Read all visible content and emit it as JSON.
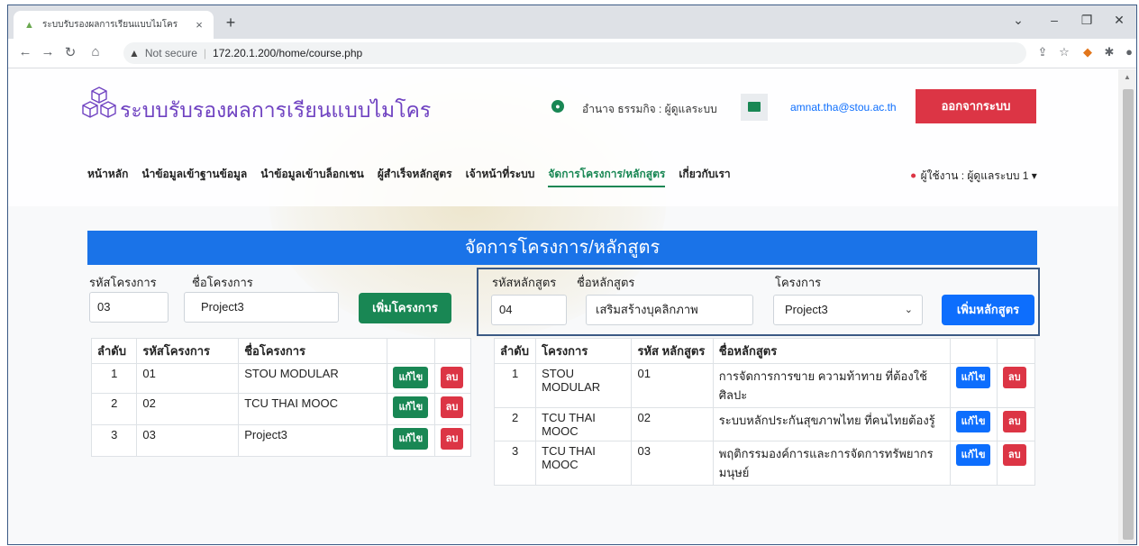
{
  "browser": {
    "tab_title": "ระบบรับรองผลการเรียนแบบไมโคร",
    "tab_close": "×",
    "new_tab": "+",
    "address_security": "Not secure",
    "address_url": "172.20.1.200/home/course.php"
  },
  "header": {
    "site_title": "ระบบรับรองผลการเรียนแบบไมโคร",
    "user_info": "อำนาจ ธรรมกิจ : ผู้ดูแลระบบ",
    "email": "amnat.tha@stou.ac.th",
    "logout_label": "ออกจากระบบ"
  },
  "nav": {
    "items": [
      {
        "label": "หน้าหลัก"
      },
      {
        "label": "นำข้อมูลเข้าฐานข้อมูล"
      },
      {
        "label": "นำข้อมูลเข้าบล็อกเชน"
      },
      {
        "label": "ผู้สำเร็จหลักสูตร"
      },
      {
        "label": "เจ้าหน้าที่ระบบ"
      },
      {
        "label": "จัดการโครงการ/หลักสูตร"
      },
      {
        "label": "เกี่ยวกับเรา"
      }
    ],
    "active_index": 5,
    "user_menu": "ผู้ใช้งาน : ผู้ดูแลระบบ 1"
  },
  "main": {
    "banner_title": "จัดการโครงการ/หลักสูตร",
    "project_form": {
      "code_label": "รหัสโครงการ",
      "code_value": "03",
      "name_label": "ชื่อโครงการ",
      "name_value": "Project3",
      "add_button": "เพิ่มโครงการ"
    },
    "course_form": {
      "code_label": "รหัสหลักสูตร",
      "code_value": "04",
      "name_label": "ชื่อหลักสูตร",
      "name_value": "เสริมสร้างบุคลิกภาพ",
      "project_label": "โครงการ",
      "project_selected": "Project3",
      "add_button": "เพิ่มหลักสูตร"
    },
    "project_table": {
      "headers": [
        "ลำดับ",
        "รหัสโครงการ",
        "ชื่อโครงการ"
      ],
      "rows": [
        {
          "no": "1",
          "code": "01",
          "name": "STOU MODULAR"
        },
        {
          "no": "2",
          "code": "02",
          "name": "TCU THAI MOOC"
        },
        {
          "no": "3",
          "code": "03",
          "name": "Project3"
        }
      ],
      "edit_label": "แก้ไข",
      "delete_label": "ลบ"
    },
    "course_table": {
      "headers": [
        "ลำดับ",
        "โครงการ",
        "รหัส หลักสูตร",
        "ชื่อหลักสูตร"
      ],
      "rows": [
        {
          "no": "1",
          "project": "STOU MODULAR",
          "code": "01",
          "name": "การจัดการการขาย ความท้าทาย ที่ต้องใช้ศิลปะ"
        },
        {
          "no": "2",
          "project": "TCU THAI MOOC",
          "code": "02",
          "name": "ระบบหลักประกันสุขภาพไทย ที่คนไทยต้องรู้"
        },
        {
          "no": "3",
          "project": "TCU THAI MOOC",
          "code": "03",
          "name": "พฤติกรรมองค์การและการจัดการทรัพยากรมนุษย์"
        }
      ],
      "edit_label": "แก้ไข",
      "delete_label": "ลบ"
    }
  }
}
